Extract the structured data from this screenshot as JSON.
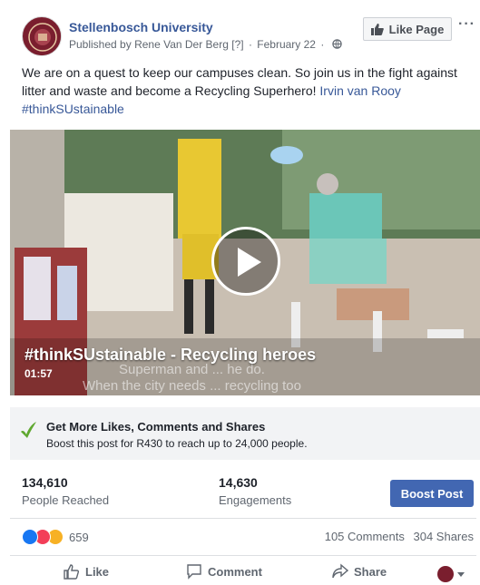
{
  "header": {
    "page_name": "Stellenbosch University",
    "published_by_prefix": "Published by",
    "publisher": "Rene Van Der Berg",
    "publisher_flag": "[?]",
    "date": "February 22",
    "privacy_icon": "globe-icon",
    "like_page_label": "Like Page",
    "more_label": "···"
  },
  "post": {
    "text": "We are on a quest to keep our campuses clean. So join us in the fight against litter and waste and become a Recycling Superhero!",
    "tag_person": "Irvin van Rooy",
    "hashtag": "#thinkSUstainable"
  },
  "video": {
    "title": "#thinkSUstainable - Recycling heroes",
    "duration": "01:57",
    "caption_line1": "Superman and ... he do.",
    "caption_line2": "When the city needs ... recycling too"
  },
  "boost_promo": {
    "title": "Get More Likes, Comments and Shares",
    "text": "Boost this post for R430 to reach up to 24,000 people."
  },
  "insights": {
    "reached_value": "134,610",
    "reached_label": "People Reached",
    "engagements_value": "14,630",
    "engagements_label": "Engagements",
    "boost_button_label": "Boost Post"
  },
  "reactions": {
    "count": "659",
    "comments": "105 Comments",
    "shares": "304 Shares"
  },
  "actions": {
    "like_label": "Like",
    "comment_label": "Comment",
    "share_label": "Share"
  },
  "colors": {
    "link": "#385898",
    "boost_button": "#4267b2",
    "brand": "#7a1e2e"
  }
}
